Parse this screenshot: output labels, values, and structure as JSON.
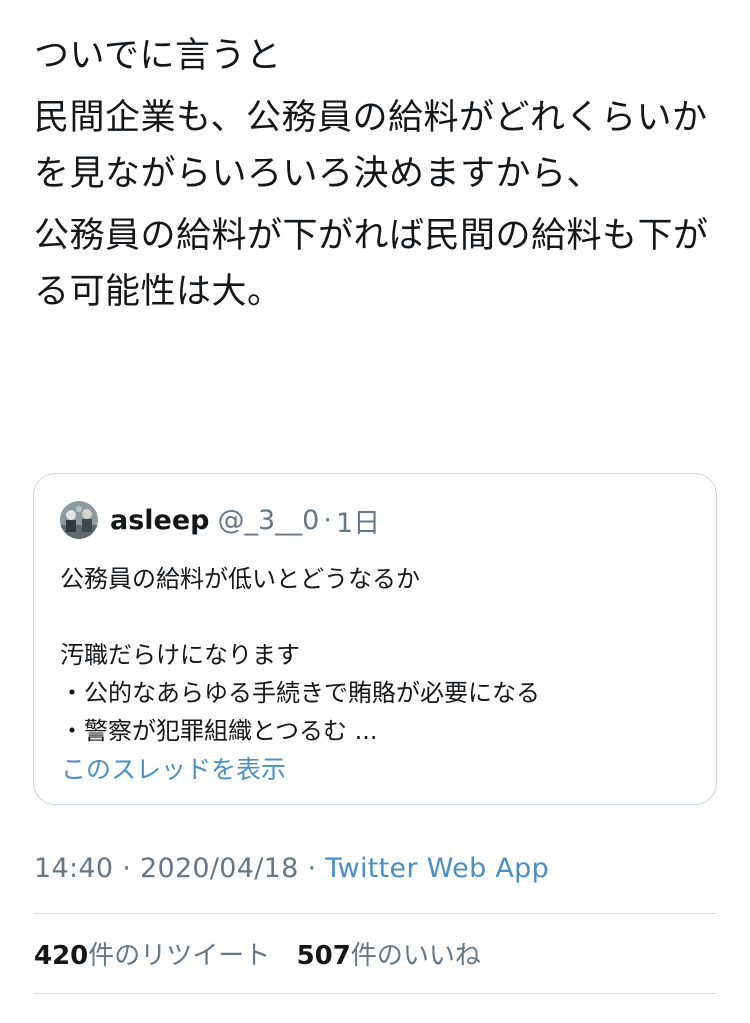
{
  "tweet": {
    "paragraphs": [
      "ついでに言うと",
      "民間企業も、公務員の給料がどれくらいかを見ながらいろいろ決めますから、",
      "公務員の給料が下がれば民間の給料も下がる可能性は大。"
    ]
  },
  "quote": {
    "display_name": "asleep",
    "handle": "@_3__0",
    "separator": "·",
    "time": "1日",
    "lines": [
      "公務員の給料が低いとどうなるか",
      "",
      "汚職だらけになります",
      "・公的なあらゆる手続きで賄賂が必要になる",
      "・警察が犯罪組織とつるむ ..."
    ],
    "show_thread": "このスレッドを表示"
  },
  "meta": {
    "time": "14:40",
    "separator": "·",
    "date": "2020/04/18",
    "separator2": "·",
    "source": "Twitter Web App"
  },
  "stats": {
    "retweets_count": "420",
    "retweets_label": "件のリツイート",
    "likes_count": "507",
    "likes_label": "件のいいね"
  },
  "colors": {
    "text": "#14171a",
    "secondary": "#657786",
    "link": "#4a8ec4",
    "border": "#ccd6dd"
  }
}
